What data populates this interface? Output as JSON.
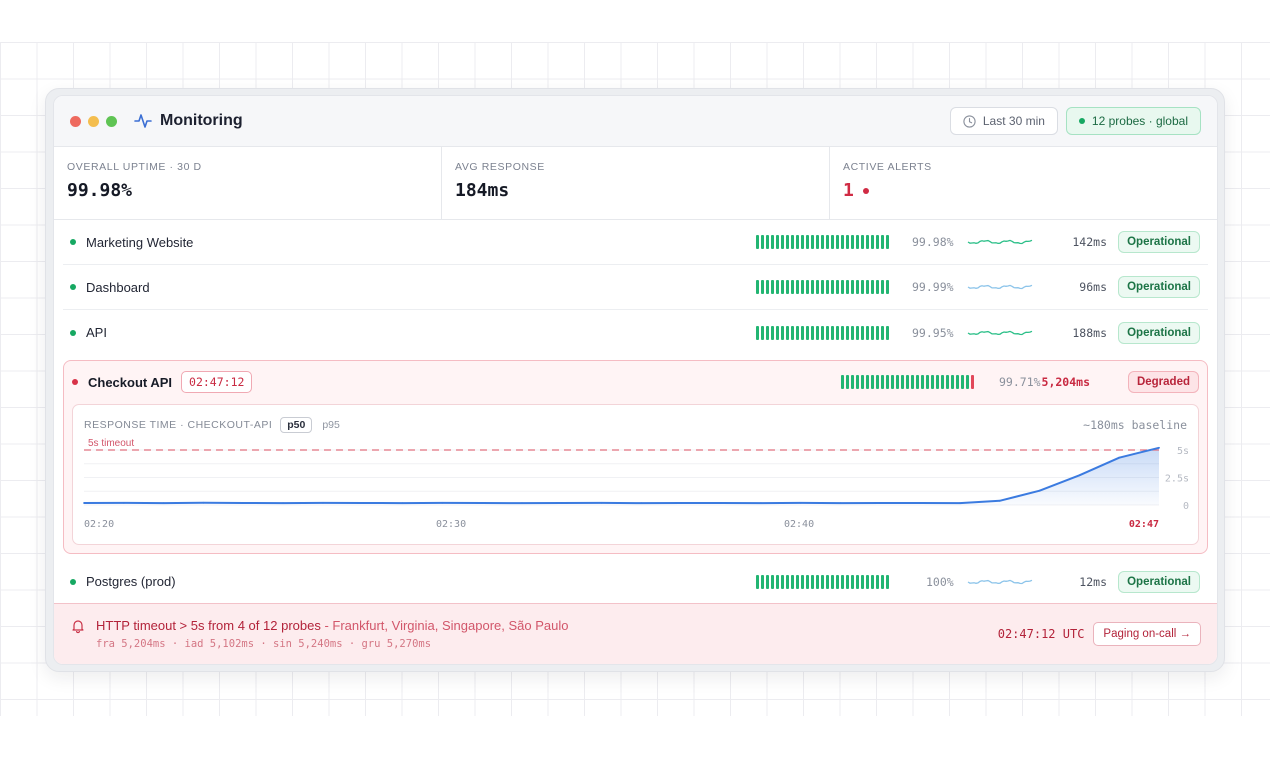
{
  "app": {
    "title": "Monitoring"
  },
  "toolbar": {
    "range_label": "Last 30 min",
    "probes_label": "12 probes · global"
  },
  "stats": [
    {
      "label": "OVERALL UPTIME · 30 D",
      "value": "99.98%"
    },
    {
      "label": "AVG RESPONSE",
      "value": "184ms"
    },
    {
      "label": "ACTIVE ALERTS",
      "value": "1"
    }
  ],
  "services": [
    {
      "name": "Marketing Website",
      "uptime": "99.98%",
      "response": "142ms",
      "status": "Operational",
      "spark_color": "#2bbf88"
    },
    {
      "name": "Dashboard",
      "uptime": "99.99%",
      "response": "96ms",
      "status": "Operational",
      "spark_color": "#8cc4ea"
    },
    {
      "name": "API",
      "uptime": "99.95%",
      "response": "188ms",
      "status": "Operational",
      "spark_color": "#2bbf88"
    }
  ],
  "incident": {
    "name": "Checkout API",
    "timer": "02:47:12",
    "uptime": "99.71%",
    "response": "5,204ms",
    "status": "Degraded",
    "chart_label": "RESPONSE TIME · CHECKOUT-API",
    "p50": "p50",
    "p95": "p95",
    "baseline": "~180ms baseline",
    "timeout_label": "5s timeout"
  },
  "chart_data": {
    "type": "area",
    "x_tick_labels": [
      "02:20",
      "02:30",
      "02:40",
      "02:47"
    ],
    "y_tick_labels": [
      "5s",
      "2.5s",
      "0"
    ],
    "ylim": [
      0,
      5000
    ],
    "xlim": [
      0,
      27
    ],
    "threshold": 5000,
    "x": [
      0,
      1,
      2,
      3,
      4,
      5,
      6,
      7,
      8,
      9,
      10,
      11,
      12,
      13,
      14,
      15,
      16,
      17,
      18,
      19,
      20,
      21,
      22,
      23,
      24,
      25,
      26,
      27
    ],
    "values": [
      180,
      190,
      170,
      200,
      185,
      175,
      190,
      180,
      170,
      195,
      185,
      175,
      180,
      190,
      170,
      185,
      180,
      175,
      190,
      170,
      185,
      180,
      175,
      380,
      1300,
      2700,
      4300,
      5200
    ]
  },
  "extra_service": {
    "name": "Postgres (prod)",
    "uptime": "100%",
    "response": "12ms",
    "status": "Operational",
    "spark_color": "#8cc4ea"
  },
  "alert": {
    "title": "HTTP timeout > 5s from 4 of 12 probes",
    "separator": " - ",
    "cities": "Frankfurt, Virginia, Singapore, São Paulo",
    "probes": "fra 5,204ms · iad 5,102ms · sin 5,240ms · gru 5,270ms",
    "time": "02:47:12 UTC",
    "action_label": "Paging on-call →"
  },
  "colors": {
    "operational": "#16a862",
    "degraded": "#d83248",
    "accent": "#3b7be0"
  }
}
